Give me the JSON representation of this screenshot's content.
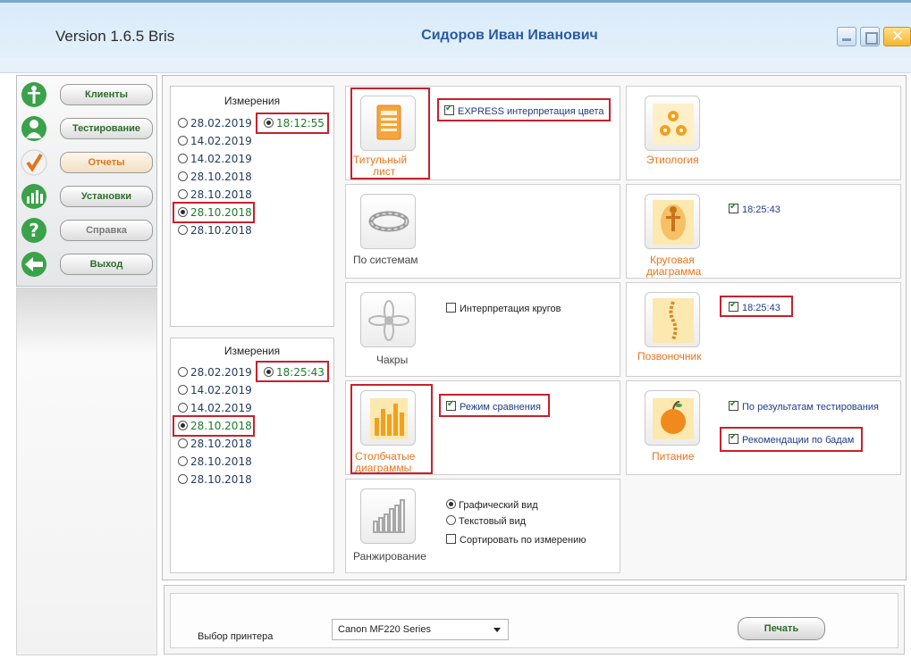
{
  "title_bar": {
    "version": "Version 1.6.5 Bris",
    "user_name": "Сидоров Иван Иванович",
    "close_glyph": "✕"
  },
  "nav": {
    "items": [
      {
        "label": "Клиенты",
        "icon": "human-figure-icon",
        "color": "#3aa24a"
      },
      {
        "label": "Тестирование",
        "icon": "person-icon",
        "color": "#3aa24a"
      },
      {
        "label": "Отчеты",
        "icon": "checkmark-icon",
        "color": "#e2731c",
        "active": true
      },
      {
        "label": "Установки",
        "icon": "bars-settings-icon",
        "color": "#3aa24a"
      },
      {
        "label": "Справка",
        "icon": "question-icon",
        "color": "#3aa24a"
      },
      {
        "label": "Выход",
        "icon": "exit-arrow-icon",
        "color": "#3aa24a"
      }
    ]
  },
  "measurements_1": {
    "title": "Измерения",
    "time": "18:12:55",
    "rows": [
      "28.02.2019",
      "14.02.2019",
      "14.02.2019",
      "28.10.2018",
      "28.10.2018",
      "28.10.2018",
      "28.10.2018"
    ],
    "selected_index": 5
  },
  "measurements_2": {
    "title": "Измерения",
    "time": "18:25:43",
    "rows": [
      "28.02.2019",
      "14.02.2019",
      "14.02.2019",
      "28.10.2018",
      "28.10.2018",
      "28.10.2018",
      "28.10.2018"
    ],
    "selected_index": 3
  },
  "reports": {
    "title_page": {
      "label_line1": "Титульный",
      "label_line2": "лист",
      "option": "EXPRESS интерпретация цвета",
      "checked": true
    },
    "etiology": {
      "label": "Этиология"
    },
    "by_systems": {
      "label": "По системам"
    },
    "circular": {
      "label_line1": "Круговая",
      "label_line2": "диаграмма",
      "option": "18:25:43",
      "checked": true
    },
    "chakras": {
      "label": "Чакры",
      "option": "Интерпретация кругов",
      "checked": false
    },
    "spine": {
      "label": "Позвоночник",
      "option": "18:25:43",
      "checked": true
    },
    "bar_charts": {
      "label_line1": "Столбчатые",
      "label_line2": "диаграммы",
      "option": "Режим сравнения",
      "checked": true
    },
    "nutrition": {
      "label": "Питание",
      "option1": "По результатам тестирования",
      "option2": "Рекомендации по бадам",
      "checked1": true,
      "checked2": true
    },
    "ranking": {
      "label": "Ранжирование",
      "option_graphic": "Графический вид",
      "option_text": "Текстовый вид",
      "option_sort": "Сортировать по измерению",
      "graphic_selected": true,
      "sort_checked": false
    }
  },
  "printer": {
    "label": "Выбор принтера",
    "selected": "Canon MF220 Series",
    "print_button": "Печать"
  },
  "colors": {
    "accent_orange": "#e8741c",
    "highlight_red": "#c8202c",
    "nav_green": "#2e6b2e",
    "title_blue": "#2a5aa0"
  }
}
